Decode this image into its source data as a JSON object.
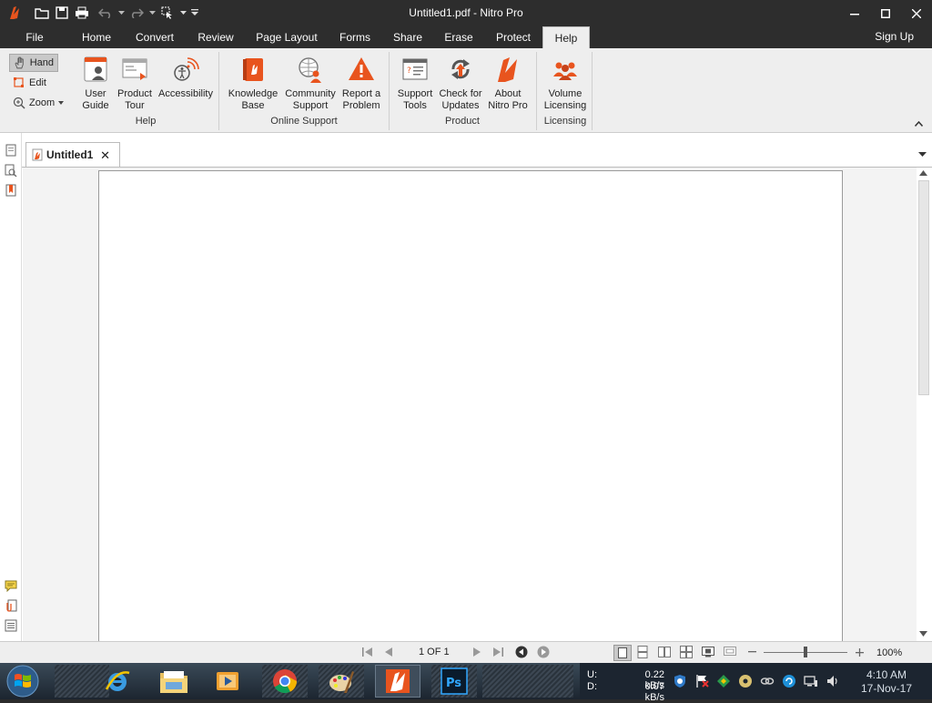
{
  "window": {
    "title": "Untitled1.pdf - Nitro Pro"
  },
  "menu": {
    "file": "File",
    "tabs": [
      "Home",
      "Convert",
      "Review",
      "Page Layout",
      "Forms",
      "Share",
      "Erase",
      "Protect",
      "Help"
    ],
    "active_tab": "Help",
    "sign_up": "Sign Up"
  },
  "tools": {
    "hand": "Hand",
    "edit": "Edit",
    "zoom": "Zoom"
  },
  "ribbon": {
    "groups": [
      {
        "label": "Help",
        "buttons": [
          {
            "line1": "User",
            "line2": "Guide"
          },
          {
            "line1": "Product",
            "line2": "Tour"
          },
          {
            "line1": "Accessibility",
            "line2": ""
          }
        ]
      },
      {
        "label": "Online Support",
        "buttons": [
          {
            "line1": "Knowledge",
            "line2": "Base"
          },
          {
            "line1": "Community",
            "line2": "Support"
          },
          {
            "line1": "Report a",
            "line2": "Problem"
          }
        ]
      },
      {
        "label": "Product",
        "buttons": [
          {
            "line1": "Support",
            "line2": "Tools"
          },
          {
            "line1": "Check for",
            "line2": "Updates"
          },
          {
            "line1": "About",
            "line2": "Nitro Pro"
          }
        ]
      },
      {
        "label": "Licensing",
        "buttons": [
          {
            "line1": "Volume",
            "line2": "Licensing"
          }
        ]
      }
    ]
  },
  "document": {
    "tab_label": "Untitled1"
  },
  "status": {
    "page_info": "1 OF 1",
    "zoom": "100%"
  },
  "taskbar": {
    "upload_label": "U:",
    "download_label": "D:",
    "upload_speed": "0.22 kB/s",
    "download_speed": "0.07 kB/s",
    "time": "4:10 AM",
    "date": "17-Nov-17"
  },
  "colors": {
    "accent": "#e8541e",
    "titlebar": "#2d2d2d",
    "ribbon": "#eeeeee"
  }
}
